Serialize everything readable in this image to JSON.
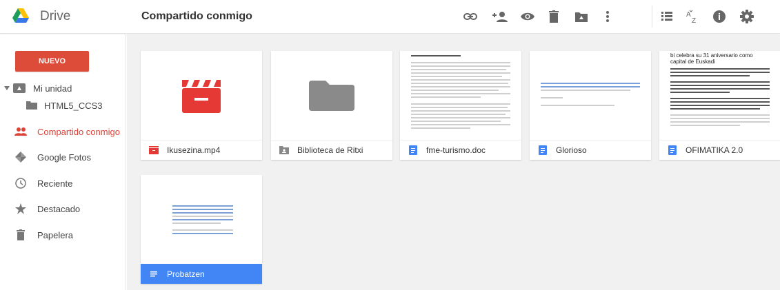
{
  "app": {
    "name": "Drive",
    "colors": {
      "accent": "#4285f4",
      "new_button": "#dd4b39",
      "active_nav": "#db4437"
    }
  },
  "header": {
    "title": "Compartido conmigo",
    "icons": [
      "link-icon",
      "add-person-icon",
      "preview-eye-icon",
      "trash-icon",
      "add-to-drive-icon",
      "more-vert-icon",
      "list-view-icon",
      "sort-az-icon",
      "info-icon",
      "settings-gear-icon"
    ]
  },
  "sidebar": {
    "new_label": "NUEVO",
    "items": [
      {
        "label": "Mi unidad",
        "icon": "drive-folder-icon"
      },
      {
        "label": "HTML5_CCS3",
        "icon": "folder-icon"
      },
      {
        "label": "Compartido conmigo",
        "icon": "shared-people-icon",
        "active": true
      },
      {
        "label": "Google Fotos",
        "icon": "photos-pinwheel-icon"
      },
      {
        "label": "Reciente",
        "icon": "clock-icon"
      },
      {
        "label": "Destacado",
        "icon": "star-icon"
      },
      {
        "label": "Papelera",
        "icon": "trash-icon"
      }
    ]
  },
  "files": [
    {
      "name": "Ikusezina.mp4",
      "type": "video",
      "icon": "video-clapper-icon"
    },
    {
      "name": "Biblioteca de Ritxi",
      "type": "shared-folder",
      "icon": "shared-folder-icon"
    },
    {
      "name": "fme-turismo.doc",
      "type": "doc",
      "icon": "docs-icon"
    },
    {
      "name": "Glorioso",
      "type": "doc",
      "icon": "docs-icon"
    },
    {
      "name": "OFIMATIKA 2.0",
      "type": "doc",
      "icon": "docs-icon"
    },
    {
      "name": "Probatzen",
      "type": "doc",
      "icon": "docs-icon",
      "selected": true
    }
  ],
  "previews": {
    "ofimatika_heading": "bi celebra su 31 aniversario como capital de Euskadi"
  }
}
